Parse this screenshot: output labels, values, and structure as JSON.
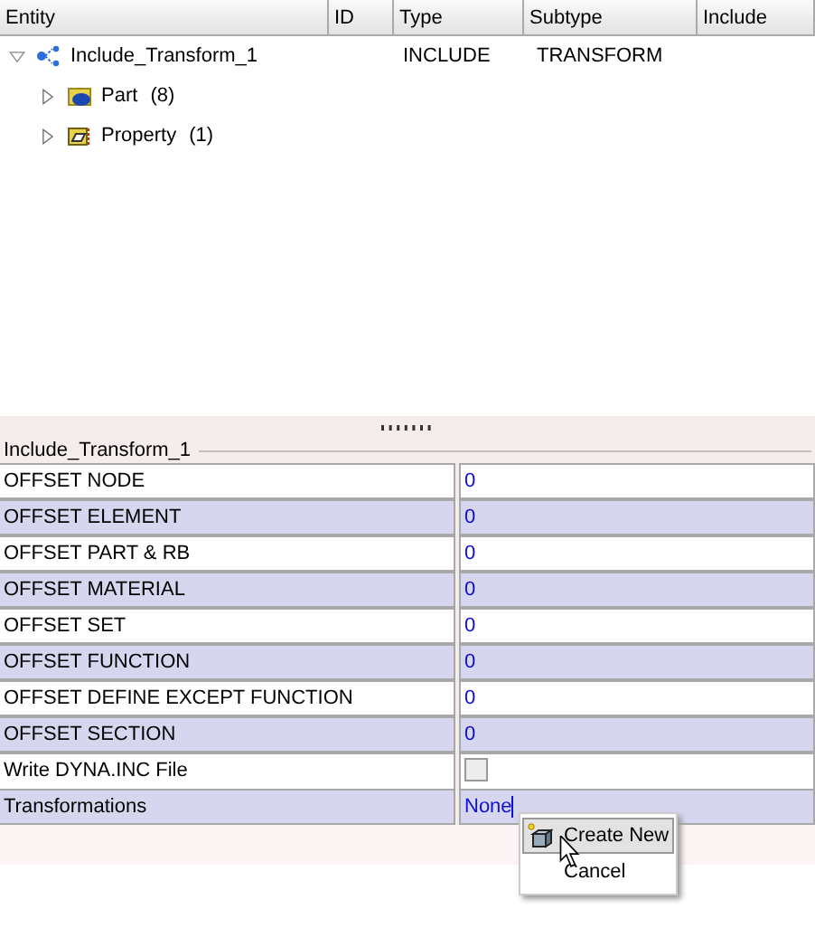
{
  "tree": {
    "columns": [
      "Entity",
      "ID",
      "Type",
      "Subtype",
      "Include"
    ],
    "nodes": [
      {
        "label": "Include_Transform_1",
        "type": "INCLUDE",
        "subtype": "TRANSFORM",
        "expanded": true,
        "children": [
          {
            "label": "Part",
            "count": "(8)",
            "expanded": false
          },
          {
            "label": "Property",
            "count": "(1)",
            "expanded": false
          }
        ]
      }
    ]
  },
  "properties": {
    "title": "Include_Transform_1",
    "rows": [
      {
        "label": "OFFSET NODE",
        "kind": "text",
        "value": "0"
      },
      {
        "label": "OFFSET ELEMENT",
        "kind": "text",
        "value": "0"
      },
      {
        "label": "OFFSET PART & RB",
        "kind": "text",
        "value": "0"
      },
      {
        "label": "OFFSET MATERIAL",
        "kind": "text",
        "value": "0"
      },
      {
        "label": "OFFSET SET",
        "kind": "text",
        "value": "0"
      },
      {
        "label": "OFFSET FUNCTION",
        "kind": "text",
        "value": "0"
      },
      {
        "label": "OFFSET DEFINE EXCEPT FUNCTION",
        "kind": "text",
        "value": "0"
      },
      {
        "label": "OFFSET SECTION",
        "kind": "text",
        "value": "0"
      },
      {
        "label": "Write DYNA.INC File",
        "kind": "checkbox",
        "checked": false
      },
      {
        "label": "Transformations",
        "kind": "edit",
        "value": "None"
      }
    ]
  },
  "context_menu": [
    {
      "label": "Create New",
      "selected": true
    },
    {
      "label": "Cancel",
      "selected": false
    }
  ]
}
